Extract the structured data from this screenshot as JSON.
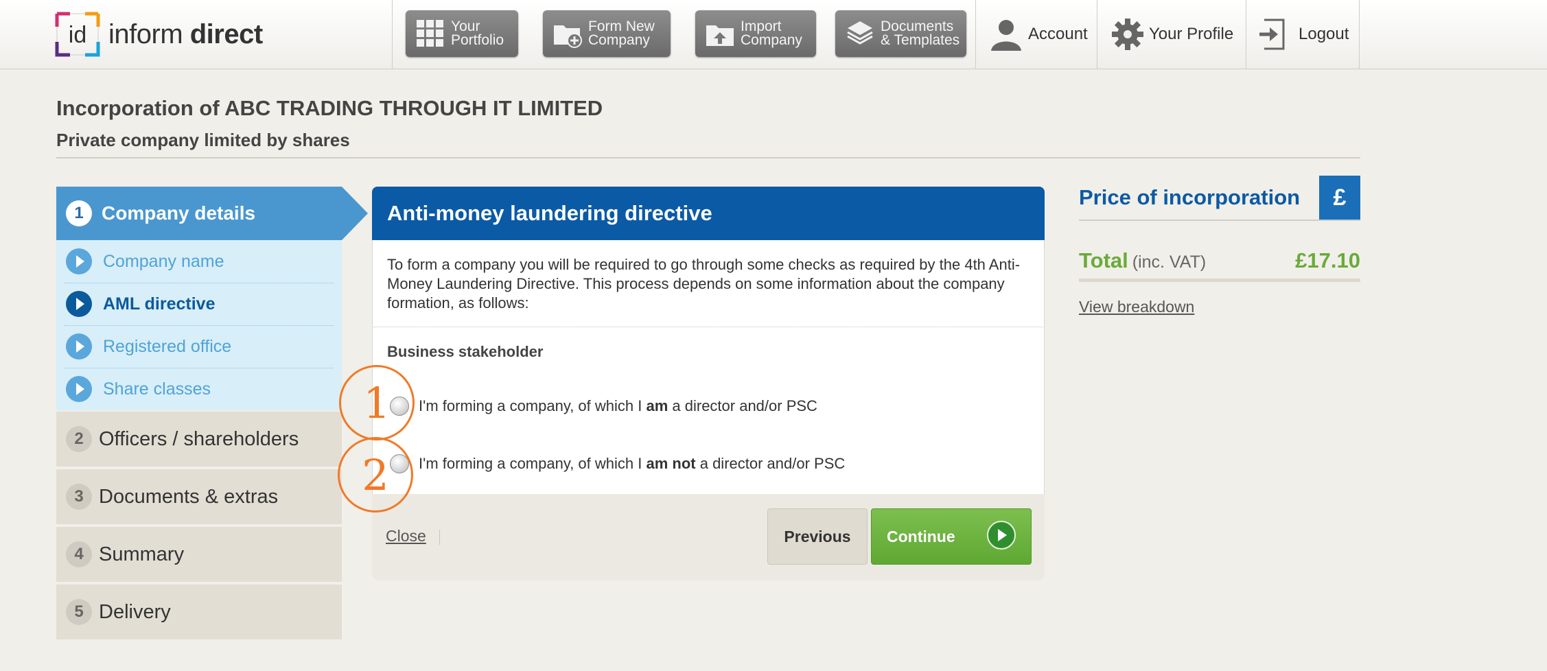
{
  "header": {
    "logo": {
      "mark": "id",
      "text_light": "inform ",
      "text_bold": "direct"
    },
    "buttons": [
      {
        "line1": "Your",
        "line2": "Portfolio",
        "icon": "grid-icon"
      },
      {
        "line1": "Form New",
        "line2": "Company",
        "icon": "folder-plus-icon"
      },
      {
        "line1": "Import",
        "line2": "Company",
        "icon": "import-icon"
      },
      {
        "line1": "Documents",
        "line2": "& Templates",
        "icon": "documents-stack-icon"
      }
    ],
    "links": [
      {
        "label": "Account",
        "icon": "person-icon"
      },
      {
        "label": "Your Profile",
        "icon": "gear-icon"
      },
      {
        "label": "Logout",
        "icon": "logout-icon"
      }
    ]
  },
  "page": {
    "title": "Incorporation of ABC TRADING THROUGH IT LIMITED",
    "subtitle": "Private company limited by shares"
  },
  "sidebar": {
    "steps": [
      {
        "num": "1",
        "label": "Company details",
        "active": true
      },
      {
        "num": "2",
        "label": "Officers / shareholders"
      },
      {
        "num": "3",
        "label": "Documents & extras"
      },
      {
        "num": "4",
        "label": "Summary"
      },
      {
        "num": "5",
        "label": "Delivery"
      }
    ],
    "substeps": [
      {
        "label": "Company name"
      },
      {
        "label": "AML directive",
        "active": true
      },
      {
        "label": "Registered office"
      },
      {
        "label": "Share classes"
      }
    ]
  },
  "panel": {
    "heading": "Anti-money laundering directive",
    "intro": "To form a company you will be required to go through some checks as required by the 4th Anti-Money Laundering Directive. This process depends on some information about the company formation, as follows:",
    "section_heading": "Business stakeholder",
    "options": [
      {
        "pre": "I'm forming a company, of which I ",
        "bold": "am",
        "post": " a director and/or PSC",
        "annotation": "1"
      },
      {
        "pre": "I'm forming a company, of which I ",
        "bold": "am not",
        "post": " a director and/or PSC",
        "annotation": "2"
      }
    ],
    "close_label": "Close",
    "previous_label": "Previous",
    "continue_label": "Continue"
  },
  "price": {
    "title": "Price of incorporation",
    "currency_symbol": "£",
    "total_label": "Total",
    "total_note": "(inc. VAT)",
    "total_value": "£17.10",
    "breakdown_label": "View breakdown"
  },
  "colors": {
    "primary_blue": "#0b5aa5",
    "step_blue": "#4a97d0",
    "substep_bg": "#d8eef9",
    "green": "#6aaa3a",
    "annotation_orange": "#f07a28"
  }
}
